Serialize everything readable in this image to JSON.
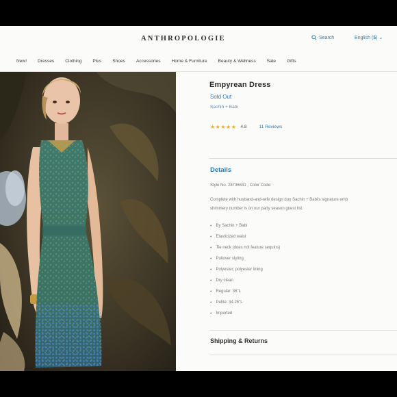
{
  "header": {
    "logo": "ANTHROPOLOGIE",
    "search_label": "Search",
    "language": "English ($) ⌄"
  },
  "nav": [
    "New!",
    "Dresses",
    "Clothing",
    "Plus",
    "Shoes",
    "Accessories",
    "Home & Furniture",
    "Beauty & Wellness",
    "Sale",
    "Gifts"
  ],
  "product": {
    "title": "Empyrean Dress",
    "status": "Sold Out",
    "brand": "Sachin + Babi",
    "stars": "★★★★★",
    "rating": "4.8",
    "reviews": "11 Reviews",
    "details_heading": "Details",
    "style_line": "Style No. 28736631 ; Color Code:",
    "description_1": "Complete with husband-and-wife design duo Sachin + Babi's signature emb",
    "description_2": "shimmery number is on our party season guest list.",
    "bullets": [
      "By Sachin + Babi",
      "Elasticized waist",
      "Tie neck (does not feature sequins)",
      "Pullover styling",
      "Polyester; polyester lining",
      "Dry clean",
      "Regular: 36\"L",
      "Petite: 34.25\"L",
      "Imported"
    ],
    "shipping_heading": "Shipping & Returns"
  },
  "colors": {
    "accent": "#2f79ad",
    "star": "#f1a81e",
    "dress": "#3f7a6e"
  }
}
